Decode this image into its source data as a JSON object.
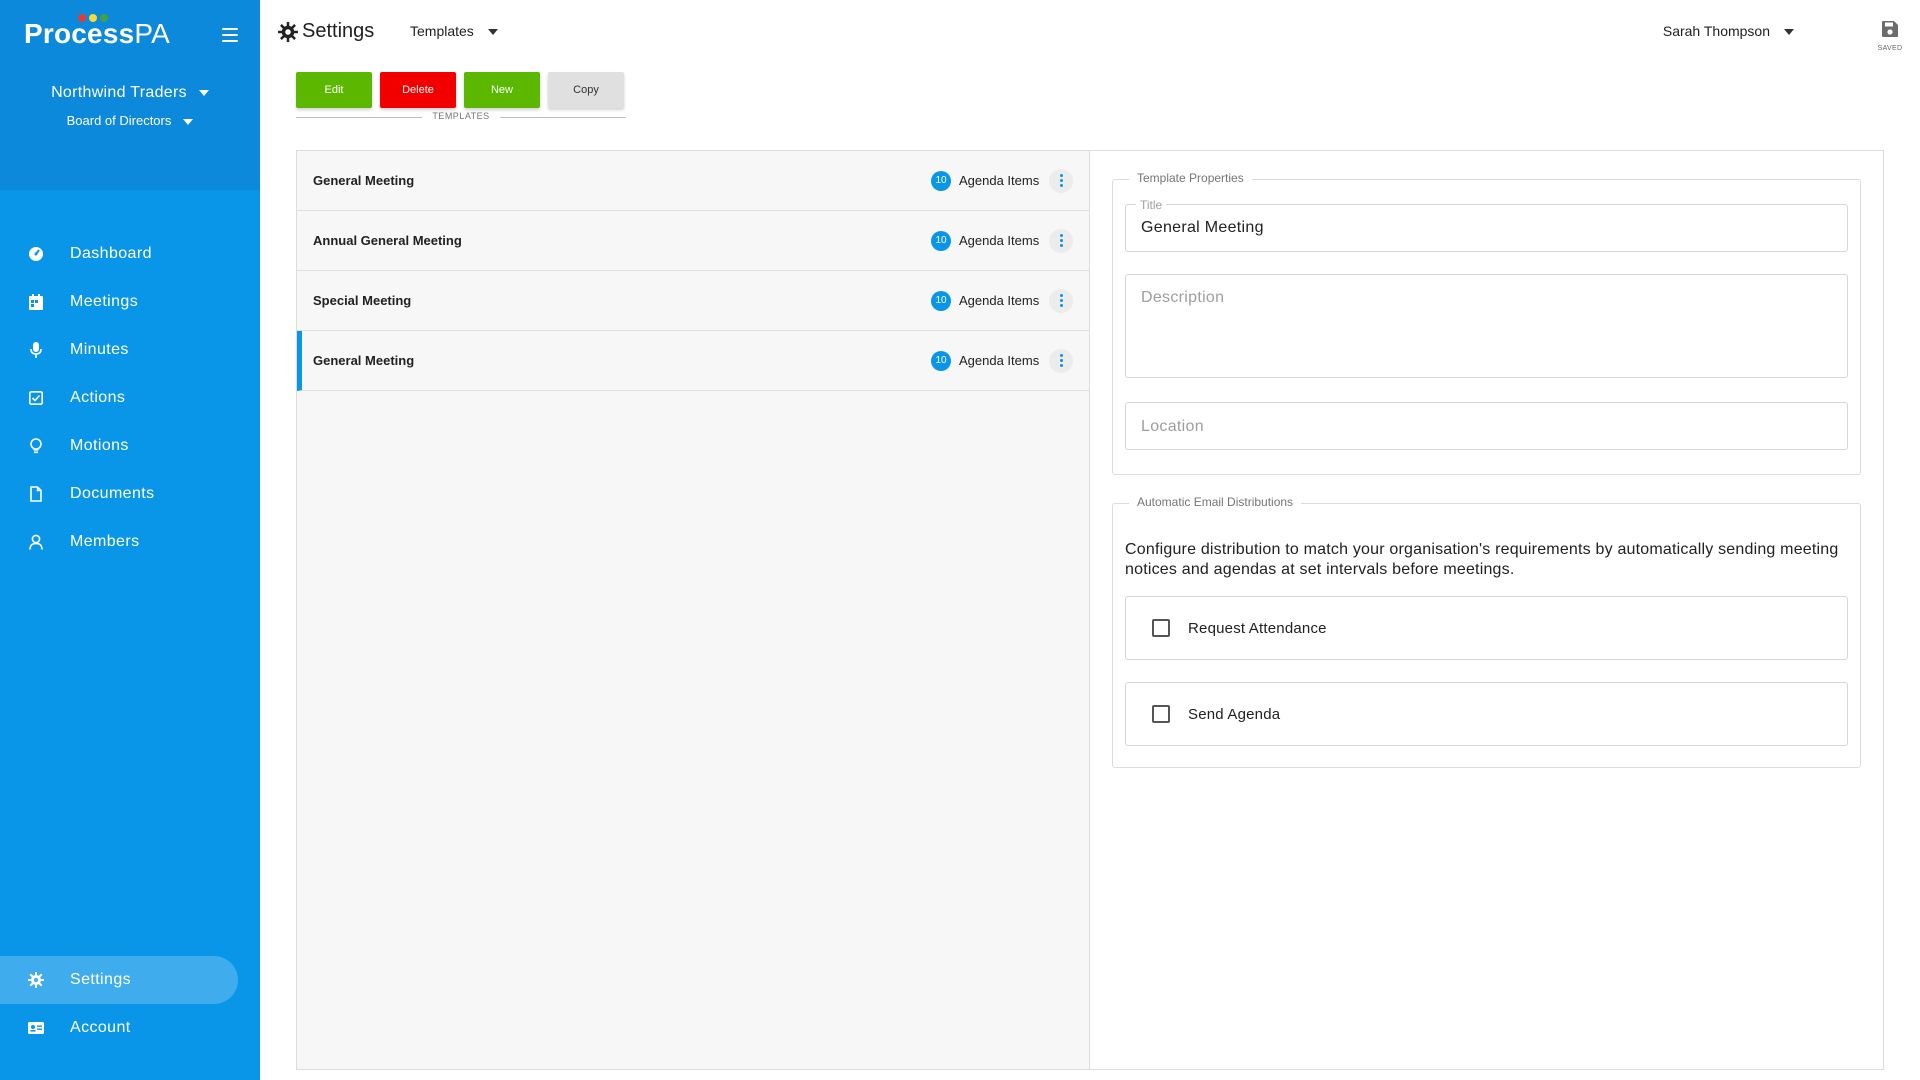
{
  "app": {
    "logo_bold": "Process",
    "logo_light": "PA",
    "logo_dot_colors": [
      "#e53935",
      "#fdd835",
      "#43a047"
    ]
  },
  "sidebar": {
    "company": "Northwind Traders",
    "board": "Board of Directors",
    "items": [
      {
        "label": "Dashboard",
        "icon": "dashboard-icon"
      },
      {
        "label": "Meetings",
        "icon": "calendar-icon"
      },
      {
        "label": "Minutes",
        "icon": "microphone-icon"
      },
      {
        "label": "Actions",
        "icon": "checkbox-icon"
      },
      {
        "label": "Motions",
        "icon": "lightbulb-icon"
      },
      {
        "label": "Documents",
        "icon": "document-icon"
      },
      {
        "label": "Members",
        "icon": "person-icon"
      }
    ],
    "bottom_items": [
      {
        "label": "Settings",
        "icon": "gear-icon",
        "active": true
      },
      {
        "label": "Account",
        "icon": "id-card-icon"
      }
    ]
  },
  "header": {
    "title": "Settings",
    "section": "Templates",
    "user": "Sarah Thompson",
    "saved_label": "SAVED"
  },
  "toolbar": {
    "edit": "Edit",
    "delete": "Delete",
    "new": "New",
    "copy": "Copy",
    "group_label": "TEMPLATES"
  },
  "templates": [
    {
      "title": "General Meeting",
      "count": "10",
      "count_label": "Agenda Items"
    },
    {
      "title": "Annual General Meeting",
      "count": "10",
      "count_label": "Agenda Items"
    },
    {
      "title": "Special Meeting",
      "count": "10",
      "count_label": "Agenda Items"
    },
    {
      "title": "General Meeting",
      "count": "10",
      "count_label": "Agenda Items",
      "selected": true
    }
  ],
  "properties": {
    "legend": "Template Properties",
    "title_label": "Title",
    "title_value": "General Meeting",
    "description_placeholder": "Description",
    "location_placeholder": "Location"
  },
  "email": {
    "legend": "Automatic Email Distributions",
    "description": "Configure distribution to match your organisation's requirements by automatically sending meeting notices and agendas at set intervals before meetings.",
    "options": [
      {
        "label": "Request Attendance",
        "checked": false
      },
      {
        "label": "Send Agenda",
        "checked": false
      }
    ]
  },
  "colors": {
    "primary": "#0a96e8",
    "success": "#5cb700",
    "danger": "#f20000"
  }
}
